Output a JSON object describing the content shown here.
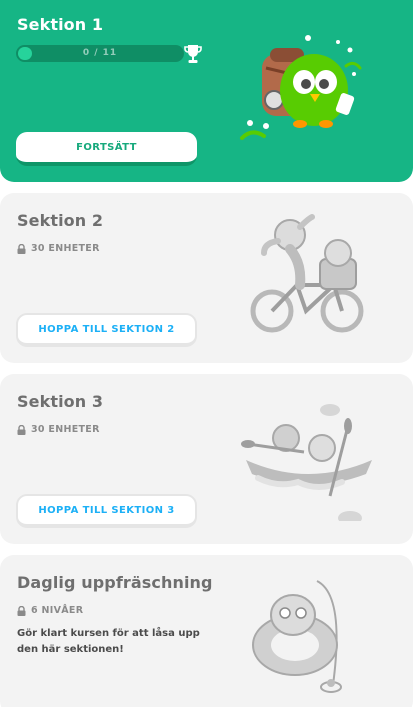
{
  "sections": [
    {
      "title": "Sektion 1",
      "progress": {
        "text": "0 / 11",
        "current": 0,
        "total": 11
      },
      "button_label": "FORTSÄTT",
      "state": "active"
    },
    {
      "title": "Sektion 2",
      "meta": "30 ENHETER",
      "button_label": "HOPPA TILL SEKTION 2",
      "state": "locked"
    },
    {
      "title": "Sektion 3",
      "meta": "30 ENHETER",
      "button_label": "HOPPA TILL SEKTION 3",
      "state": "locked"
    },
    {
      "title": "Daglig uppfräschning",
      "meta": "6 NIVÅER",
      "description": "Gör klart kursen för att låsa upp den här sektionen!",
      "state": "locked"
    }
  ],
  "colors": {
    "active_bg": "#16b585",
    "locked_bg": "#f3f3f3",
    "jump_text": "#1cb0f6",
    "continue_text": "#16a97c"
  }
}
